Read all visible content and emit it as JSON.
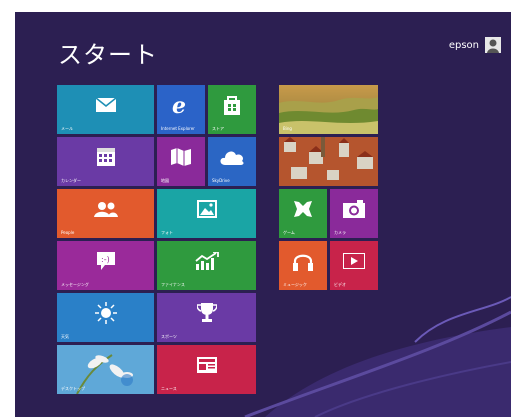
{
  "screen_title": "スタート",
  "user": {
    "name": "epson"
  },
  "tiles": {
    "mail": {
      "label": "メール",
      "color": "#1e8fb5",
      "icon": "mail-icon"
    },
    "ie": {
      "label": "Internet Explorer",
      "color": "#2b63c8",
      "icon": "internet-explorer-icon"
    },
    "store": {
      "label": "ストア",
      "color": "#2f9a3e",
      "icon": "store-bag-icon"
    },
    "calendar": {
      "label": "カレンダー",
      "color": "#6a3aa5",
      "icon": "calendar-icon"
    },
    "maps": {
      "label": "地図",
      "color": "#8a2a9a",
      "icon": "map-icon"
    },
    "skydrive": {
      "label": "SkyDrive",
      "color": "#2b66c4",
      "icon": "cloud-icon"
    },
    "people": {
      "label": "People",
      "color": "#e25a2d",
      "icon": "people-icon"
    },
    "photos": {
      "label": "フォト",
      "color": "#1aa5a5",
      "icon": "photo-icon"
    },
    "messaging": {
      "label": "メッセージング",
      "color": "#9a2a9a",
      "icon": "chat-smiley-icon"
    },
    "finance": {
      "label": "ファイナンス",
      "color": "#2f9a3e",
      "icon": "chart-up-icon"
    },
    "weather": {
      "label": "天気",
      "color": "#2a80c8",
      "icon": "sun-icon"
    },
    "sports": {
      "label": "スポーツ",
      "color": "#6a3aa5",
      "icon": "trophy-icon"
    },
    "desktop": {
      "label": "デスクトップ",
      "color": "#5fa8d8",
      "icon": "desktop-flower-image"
    },
    "news": {
      "label": "ニュース",
      "color": "#c8234a",
      "icon": "newspaper-icon"
    },
    "bing": {
      "label": "Bing",
      "color": "#9b8f3a",
      "icon": "landscape-image"
    },
    "travel": {
      "label": "",
      "color": "#b5552e",
      "icon": "city-rooftops-image"
    },
    "games": {
      "label": "ゲーム",
      "color": "#2f9a3e",
      "icon": "game-controller-icon"
    },
    "camera": {
      "label": "カメラ",
      "color": "#8a2a9a",
      "icon": "camera-icon"
    },
    "music": {
      "label": "ミュージック",
      "color": "#e25a2d",
      "icon": "headphones-icon"
    },
    "video": {
      "label": "ビデオ",
      "color": "#c8234a",
      "icon": "play-icon"
    }
  }
}
